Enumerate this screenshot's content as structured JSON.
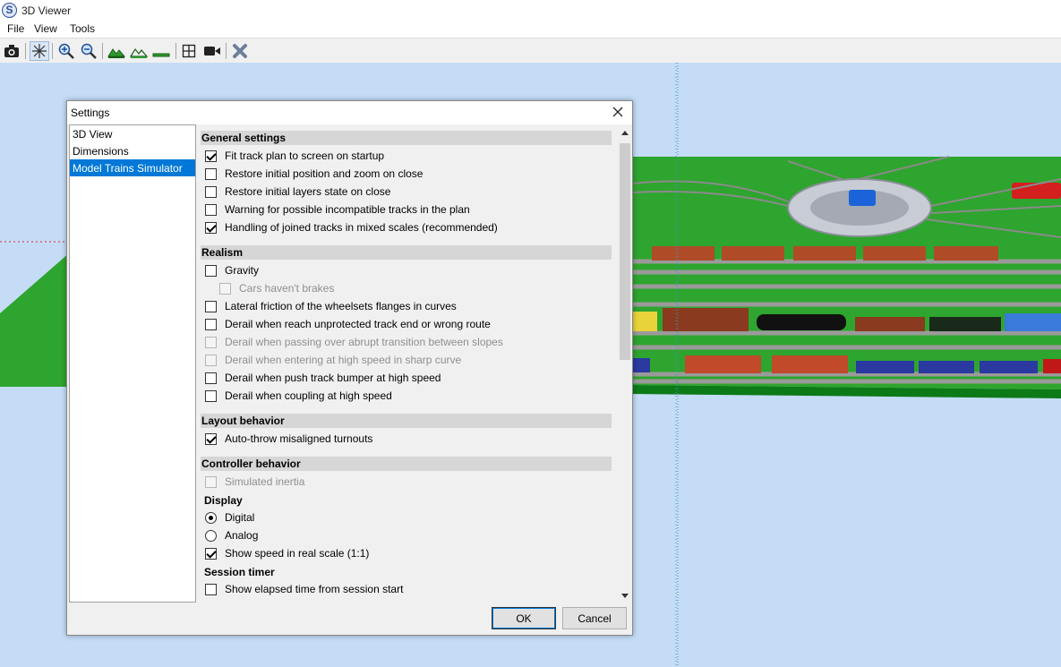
{
  "window": {
    "title": "3D Viewer",
    "icon_letter": "S"
  },
  "menu": [
    {
      "label": "File"
    },
    {
      "label": "View"
    },
    {
      "label": "Tools"
    }
  ],
  "toolbar": {
    "buttons": [
      {
        "icon": "camera-icon"
      },
      {
        "icon": "aerial-view-icon",
        "pressed": true
      },
      {
        "icon": "zoom-in-icon"
      },
      {
        "icon": "zoom-out-icon"
      },
      {
        "icon": "terrain-icon"
      },
      {
        "icon": "terrain-outline-icon"
      },
      {
        "icon": "flat-ground-icon"
      },
      {
        "icon": "display-all-icon"
      },
      {
        "icon": "video-camera-icon"
      },
      {
        "icon": "close-view-icon"
      }
    ]
  },
  "dialog": {
    "title": "Settings",
    "nav": [
      {
        "label": "3D View",
        "selected": false
      },
      {
        "label": "Dimensions",
        "selected": false
      },
      {
        "label": "Model Trains Simulator",
        "selected": true
      }
    ],
    "sections": {
      "general": {
        "title": "General settings",
        "options": [
          {
            "label": "Fit track plan to screen on startup",
            "checked": true,
            "enabled": true
          },
          {
            "label": "Restore initial position and zoom on close",
            "checked": false,
            "enabled": true
          },
          {
            "label": "Restore initial layers state on close",
            "checked": false,
            "enabled": true
          },
          {
            "label": "Warning for possible incompatible tracks in the plan",
            "checked": false,
            "enabled": true
          },
          {
            "label": "Handling of joined tracks in mixed scales (recommended)",
            "checked": true,
            "enabled": true
          }
        ]
      },
      "realism": {
        "title": "Realism",
        "options": [
          {
            "label": "Gravity",
            "checked": false,
            "enabled": true
          },
          {
            "label": "Cars haven't brakes",
            "checked": false,
            "enabled": false
          },
          {
            "label": "Lateral friction of the wheelsets flanges in curves",
            "checked": false,
            "enabled": true
          },
          {
            "label": "Derail when reach unprotected track end or wrong route",
            "checked": false,
            "enabled": true
          },
          {
            "label": "Derail when passing over abrupt transition between slopes",
            "checked": false,
            "enabled": false
          },
          {
            "label": "Derail when entering at high speed in sharp curve",
            "checked": false,
            "enabled": false
          },
          {
            "label": "Derail when push track bumper at high speed",
            "checked": false,
            "enabled": true
          },
          {
            "label": "Derail when coupling at high speed",
            "checked": false,
            "enabled": true
          }
        ]
      },
      "layout": {
        "title": "Layout behavior",
        "options": [
          {
            "label": "Auto-throw misaligned turnouts",
            "checked": true,
            "enabled": true
          }
        ]
      },
      "controller": {
        "title": "Controller behavior",
        "inertia": {
          "label": "Simulated inertia",
          "checked": false,
          "enabled": false
        },
        "display_title": "Display",
        "digital": {
          "label": "Digital",
          "selected": true
        },
        "analog": {
          "label": "Analog",
          "selected": false
        },
        "real_scale": {
          "label": "Show speed in real scale (1:1)",
          "checked": true,
          "enabled": true
        },
        "timer_title": "Session timer",
        "elapsed": {
          "label": "Show elapsed time from session start",
          "checked": false,
          "enabled": true
        }
      }
    },
    "buttons": {
      "ok": "OK",
      "cancel": "Cancel"
    }
  },
  "scene_colors": {
    "sky": "#c5dcf7",
    "grass": "#2ea52e",
    "selection": "#0078d7"
  }
}
